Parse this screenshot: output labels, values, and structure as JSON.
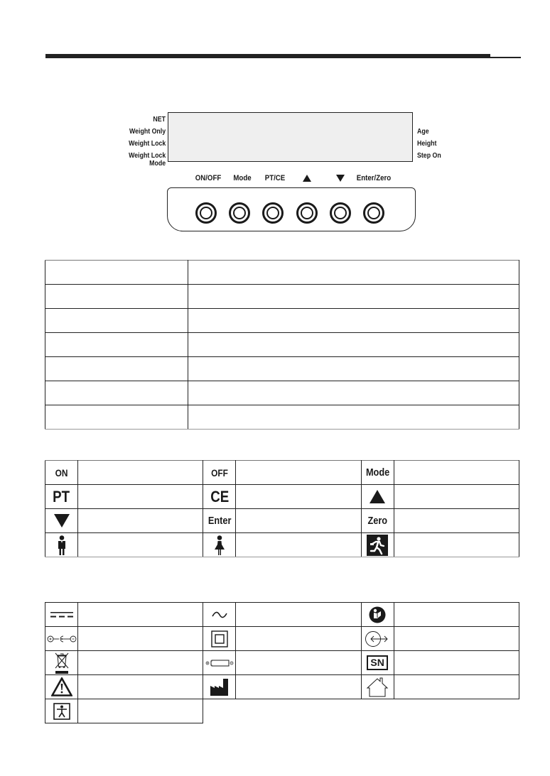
{
  "header": {
    "rule": "section-divider"
  },
  "lcd": {
    "left_labels": [
      "NET",
      "Weight  Only",
      "Weight Lock",
      "Weight Lock",
      "Mode"
    ],
    "right_labels": [
      "Age",
      "Height",
      "Step On"
    ]
  },
  "keypad": {
    "labels": {
      "on_off": "ON/OFF",
      "mode": "Mode",
      "pt_ce": "PT/CE",
      "up": "up-triangle-icon",
      "down": "down-triangle-icon",
      "enter_zero": "Enter/Zero"
    },
    "buttons": [
      "on-off",
      "mode",
      "pt-ce",
      "up",
      "down",
      "enter-zero"
    ]
  },
  "description_table": {
    "rows": [
      [
        "",
        ""
      ],
      [
        "",
        ""
      ],
      [
        "",
        ""
      ],
      [
        "",
        ""
      ],
      [
        "",
        ""
      ],
      [
        "",
        ""
      ],
      [
        "",
        ""
      ]
    ]
  },
  "display_symbols": {
    "rows": [
      [
        {
          "icon": "text",
          "text": "ON",
          "desc": ""
        },
        {
          "icon": "text",
          "text": "OFF",
          "desc": ""
        },
        {
          "icon": "text",
          "text": "Mode",
          "desc": ""
        }
      ],
      [
        {
          "icon": "text",
          "text": "PT",
          "desc": ""
        },
        {
          "icon": "text",
          "text": "CE",
          "desc": ""
        },
        {
          "icon": "up-triangle-icon",
          "desc": ""
        }
      ],
      [
        {
          "icon": "down-triangle-icon",
          "desc": ""
        },
        {
          "icon": "text",
          "text": "Enter",
          "desc": ""
        },
        {
          "icon": "text",
          "text": "Zero",
          "desc": ""
        }
      ],
      [
        {
          "icon": "male-icon",
          "desc": ""
        },
        {
          "icon": "female-icon",
          "desc": ""
        },
        {
          "icon": "running-person-icon",
          "desc": ""
        }
      ]
    ]
  },
  "labeling_symbols": {
    "rows": [
      [
        {
          "icon": "direct-current-icon",
          "desc": ""
        },
        {
          "icon": "alternating-current-icon",
          "desc": ""
        },
        {
          "icon": "read-manual-icon",
          "desc": ""
        }
      ],
      [
        {
          "icon": "polarity-icon",
          "desc": ""
        },
        {
          "icon": "class-ii-double-insulation-icon",
          "desc": ""
        },
        {
          "icon": "output-connector-icon",
          "desc": ""
        }
      ],
      [
        {
          "icon": "weee-bin-icon",
          "desc": ""
        },
        {
          "icon": "battery-icon",
          "desc": ""
        },
        {
          "icon": "text",
          "text": "SN",
          "desc": ""
        }
      ],
      [
        {
          "icon": "warning-triangle-icon",
          "desc": ""
        },
        {
          "icon": "manufacturer-factory-icon",
          "desc": ""
        },
        {
          "icon": "indoor-use-house-icon",
          "desc": ""
        }
      ],
      [
        {
          "icon": "type-b-applied-part-icon",
          "desc": ""
        }
      ]
    ]
  }
}
